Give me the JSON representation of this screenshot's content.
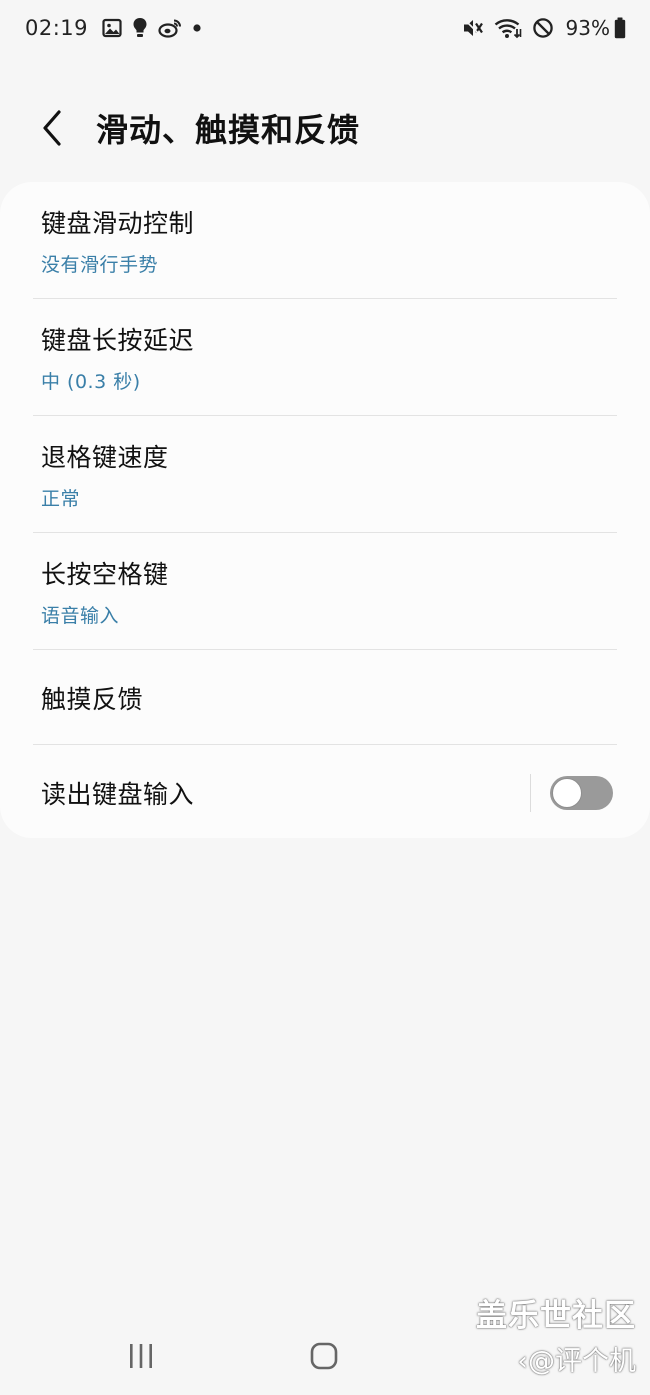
{
  "status_bar": {
    "time": "02:19",
    "battery": "93%",
    "left_icons": [
      "gallery-icon",
      "bulb-icon",
      "weibo-icon",
      "dot-icon"
    ],
    "right_icons": [
      "mute-icon",
      "wifi-icon",
      "dnd-icon",
      "battery-icon"
    ]
  },
  "header": {
    "title": "滑动、触摸和反馈"
  },
  "settings": {
    "items": [
      {
        "title": "键盘滑动控制",
        "subtitle": "没有滑行手势"
      },
      {
        "title": "键盘长按延迟",
        "subtitle": "中 (0.3 秒)"
      },
      {
        "title": "退格键速度",
        "subtitle": "正常"
      },
      {
        "title": "长按空格键",
        "subtitle": "语音输入"
      },
      {
        "title": "触摸反馈"
      },
      {
        "title": "读出键盘输入",
        "toggle": false
      }
    ]
  },
  "watermark": {
    "line1": "盖乐世社区",
    "line2": "@评个机"
  },
  "colors": {
    "accent": "#3a7fa8",
    "background": "#f6f6f6",
    "card": "#fcfcfc",
    "toggle_off": "#9a9a9a"
  }
}
